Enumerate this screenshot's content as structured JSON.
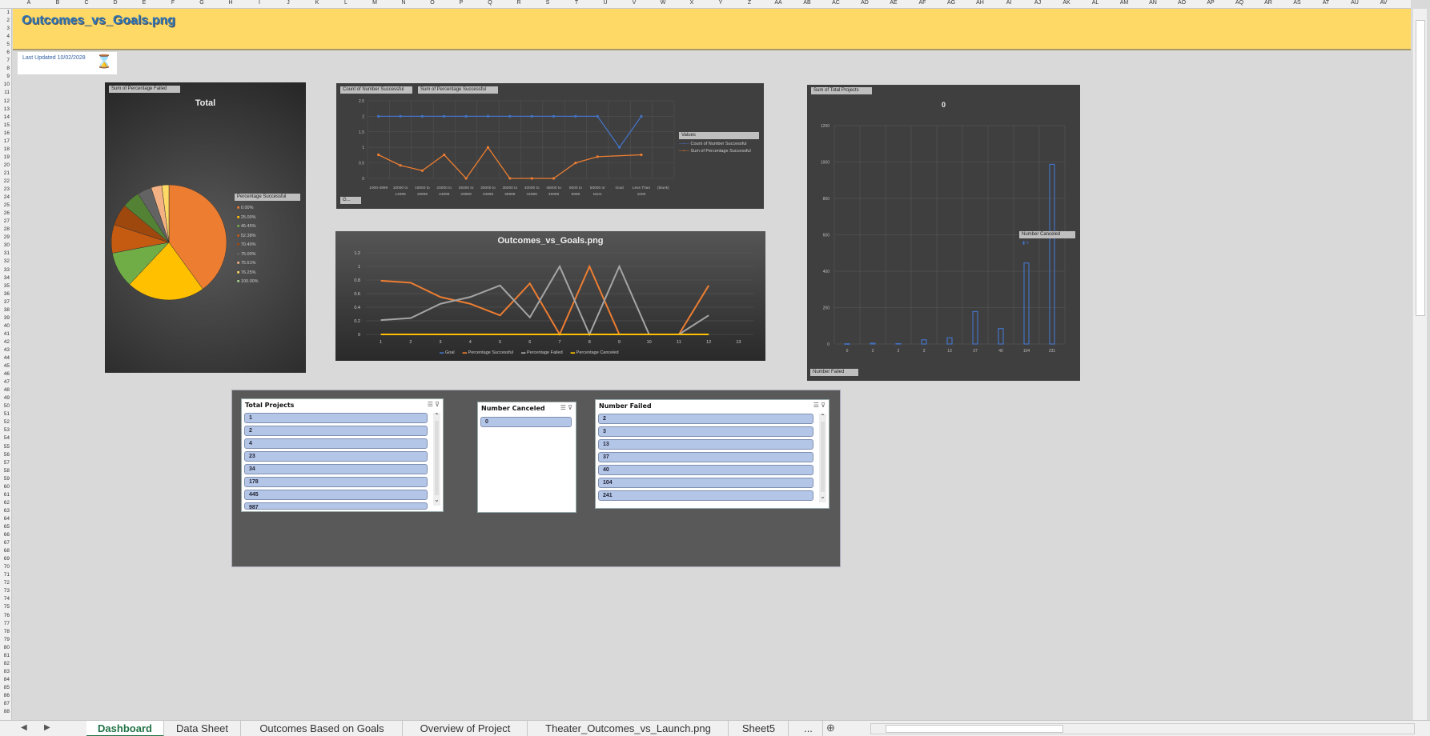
{
  "sheet": {
    "title": "Outcomes_vs_Goals.png",
    "last_updated": "Last Updated 10/02/2028",
    "columns": [
      "A",
      "B",
      "C",
      "D",
      "E",
      "F",
      "G",
      "H",
      "I",
      "J",
      "K",
      "L",
      "M",
      "N",
      "O",
      "P",
      "Q",
      "R",
      "S",
      "T",
      "U",
      "V",
      "W",
      "X",
      "Y",
      "Z",
      "AA",
      "AB",
      "AC",
      "AD",
      "AE",
      "AF",
      "AG",
      "AH",
      "AI",
      "AJ",
      "AK",
      "AL",
      "AM",
      "AN",
      "AO",
      "AP",
      "AQ",
      "AR",
      "AS",
      "AT",
      "AU",
      "AV"
    ],
    "row_count": 88
  },
  "pie": {
    "filter_chip": "Sum of Percentage Failed",
    "title": "Total",
    "legend_chip": "Percentage Successful",
    "legend": [
      {
        "label": "0.00%",
        "color": "#ed7d31"
      },
      {
        "label": "25.00%",
        "color": "#ffc000"
      },
      {
        "label": "45.45%",
        "color": "#70ad47"
      },
      {
        "label": "52.38%",
        "color": "#c55a11"
      },
      {
        "label": "70.40%",
        "color": "#9e480e"
      },
      {
        "label": "75.00%",
        "color": "#636363"
      },
      {
        "label": "75.61%",
        "color": "#f4b183"
      },
      {
        "label": "76.25%",
        "color": "#ffd966"
      },
      {
        "label": "100.00%",
        "color": "#a9d18e"
      }
    ],
    "slices": [
      0.4,
      0.22,
      0.1,
      0.08,
      0.06,
      0.05,
      0.04,
      0.03,
      0.02
    ],
    "colors": [
      "#ed7d31",
      "#ffc000",
      "#70ad47",
      "#c55a11",
      "#9e480e",
      "#548235",
      "#636363",
      "#f4b183",
      "#ffd966"
    ]
  },
  "linechart": {
    "chip1": "Count of Number Successful",
    "chip2": "Sum of Percentage Successful",
    "bottom_chip": "G...",
    "legend_title": "Values",
    "legend": [
      "Count of Number Successful",
      "Sum of Percentage Successful"
    ],
    "y_ticks": [
      "2.5",
      "2",
      "1.5",
      "1",
      "0.5",
      "0"
    ],
    "categories": [
      "1000-4999",
      "10000 to 14999",
      "15000 to 19999",
      "20000 to 24999",
      "25000 to 29999",
      "30000 to 34999",
      "35000 to 39999",
      "40000 to 44999",
      "45000 to 49999",
      "5000 to 9999",
      "50000 or More",
      "Goal",
      "Less Than 1000",
      "(blank)"
    ],
    "series_count": [
      2,
      2,
      2,
      2,
      2,
      2,
      2,
      2,
      2,
      2,
      2,
      1,
      2,
      null
    ],
    "series_pct": [
      0.76,
      0.42,
      0.25,
      0.76,
      0.0,
      1.0,
      0.0,
      0.0,
      0.0,
      0.5,
      0.7,
      null,
      0.76,
      null
    ]
  },
  "goalchart": {
    "title": "Outcomes_vs_Goals.png",
    "y_ticks": [
      "1.2",
      "1",
      "0.8",
      "0.6",
      "0.4",
      "0.2",
      "0"
    ],
    "x_ticks": [
      "1",
      "2",
      "3",
      "4",
      "5",
      "6",
      "7",
      "8",
      "9",
      "10",
      "11",
      "12",
      "13"
    ],
    "legend": [
      "Goal",
      "Percentage Successful",
      "Percentage Failed",
      "Percentage Canceled"
    ],
    "colors": [
      "#4472c4",
      "#ed7d31",
      "#a5a5a5",
      "#ffc000"
    ],
    "series": [
      [
        0,
        0,
        0,
        0,
        0,
        0,
        0,
        0,
        0,
        0,
        0,
        0
      ],
      [
        0.79,
        0.76,
        0.55,
        0.45,
        0.28,
        0.75,
        0,
        1,
        0,
        0,
        0,
        0.72
      ],
      [
        0.21,
        0.24,
        0.45,
        0.55,
        0.72,
        0.25,
        1,
        0,
        1,
        0,
        0,
        0.28
      ],
      [
        0,
        0,
        0,
        0,
        0,
        0,
        0,
        0,
        0,
        0,
        0,
        0
      ]
    ]
  },
  "barchart": {
    "filter_chip": "Sum of Total Projects",
    "title": "0",
    "legend_chip": "Number Canceled",
    "legend_item": "0",
    "bottom_chip": "Number Failed",
    "y_ticks": [
      "1200",
      "1000",
      "800",
      "600",
      "400",
      "200",
      "0"
    ],
    "categories": [
      "0",
      "3",
      "2",
      "3",
      "13",
      "37",
      "40",
      "104",
      "231"
    ],
    "values": [
      1,
      4,
      2,
      23,
      34,
      178,
      85,
      445,
      987
    ],
    "ymax": 1200
  },
  "slicers": {
    "total_projects": {
      "title": "Total Projects",
      "items": [
        "1",
        "2",
        "4",
        "23",
        "34",
        "178",
        "445",
        "987"
      ]
    },
    "number_canceled": {
      "title": "Number Canceled",
      "items": [
        "0"
      ]
    },
    "number_failed": {
      "title": "Number Failed",
      "items": [
        "2",
        "3",
        "13",
        "37",
        "40",
        "104",
        "241"
      ]
    }
  },
  "tabs": [
    "Dashboard",
    "Data Sheet",
    "Outcomes Based on Goals",
    "Overview of Project",
    "Theater_Outcomes_vs_Launch.png",
    "Sheet5",
    "..."
  ]
}
